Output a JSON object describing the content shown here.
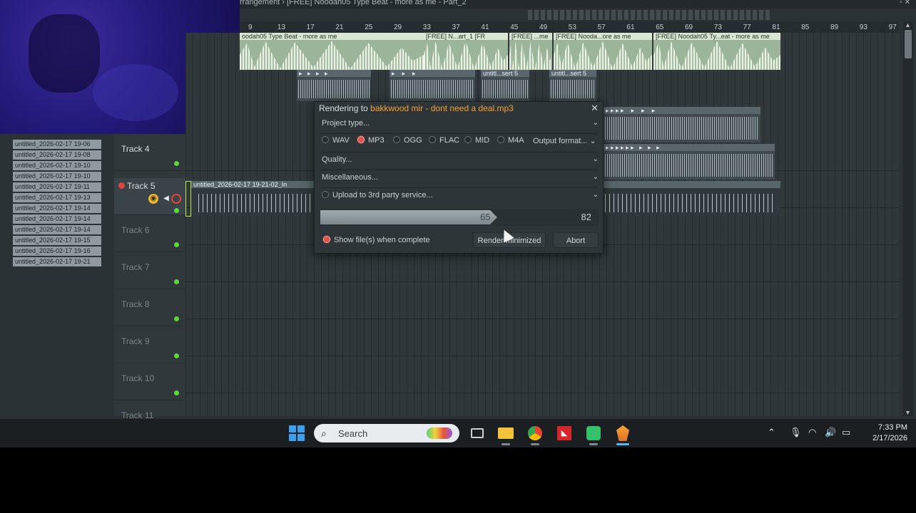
{
  "window": {
    "title": "rrangement › [FREE] Noodah05 Type Beat - more as me - Part_2"
  },
  "ruler": {
    "marks": [
      "9",
      "13",
      "17",
      "21",
      "25",
      "29",
      "33",
      "37",
      "41",
      "45",
      "49",
      "53",
      "57",
      "61",
      "65",
      "69",
      "73",
      "77",
      "81",
      "85",
      "89",
      "93",
      "97"
    ]
  },
  "patterns": [
    "untitled_2026-02-17 19-06",
    "untitled_2026-02-17 19-08",
    "untitled_2026-02-17 19-10",
    "untitled_2026-02-17 19-10",
    "untitled_2026-02-17 19-11",
    "untitled_2026-02-17 19-13",
    "untitled_2026-02-17 19-14",
    "untitled_2026-02-17 19-14",
    "untitled_2026-02-17 19-14",
    "untitled_2026-02-17 19-15",
    "untitled_2026-02-17 19-16",
    "untitled_2026-02-17 19-21"
  ],
  "tracks": {
    "t4": "Track 4",
    "t5": "Track 5",
    "t6": "Track 6",
    "t7": "Track 7",
    "t8": "Track 8",
    "t9": "Track 9",
    "t10": "Track 10",
    "t11": "Track 11"
  },
  "clips": {
    "main1": "oodah05 Type Beat - more as me",
    "main2": "[FREE] N...art_1 [FR",
    "main3": "[FREE] ...me",
    "main4": "[FREE] Nooda...ore as me",
    "main5": "[FREE] Noodah05 Ty...eat - more as me",
    "small1": "untitl...sert 5",
    "small2": "untitl...sert 5",
    "track5": "untitled_2026-02-17 19-21-02_In"
  },
  "dialog": {
    "title_prefix": "Rendering to ",
    "file_name": "bakkwood mir - dont need a deal.mp3",
    "project_type": "Project type...",
    "formats": [
      "WAV",
      "MP3",
      "OGG",
      "FLAC",
      "MID",
      "M4A"
    ],
    "selected_format": "MP3",
    "output_format": "Output format...",
    "quality": "Quality...",
    "miscellaneous": "Miscellaneous...",
    "upload": "Upload to 3rd party service...",
    "progress_value": "65",
    "progress_total": "82",
    "progress_fraction": 0.79,
    "show_files": "Show file(s) when complete",
    "render_minimized": "Render minimized",
    "abort": "Abort"
  },
  "taskbar": {
    "search_placeholder": "Search",
    "time": "7:33 PM",
    "date": "2/17/2026"
  },
  "colors": {
    "accent_orange": "#f4a234",
    "record_red": "#e0524c",
    "led_green": "#5ed63a",
    "windows_blue": "#3aa0f0"
  }
}
